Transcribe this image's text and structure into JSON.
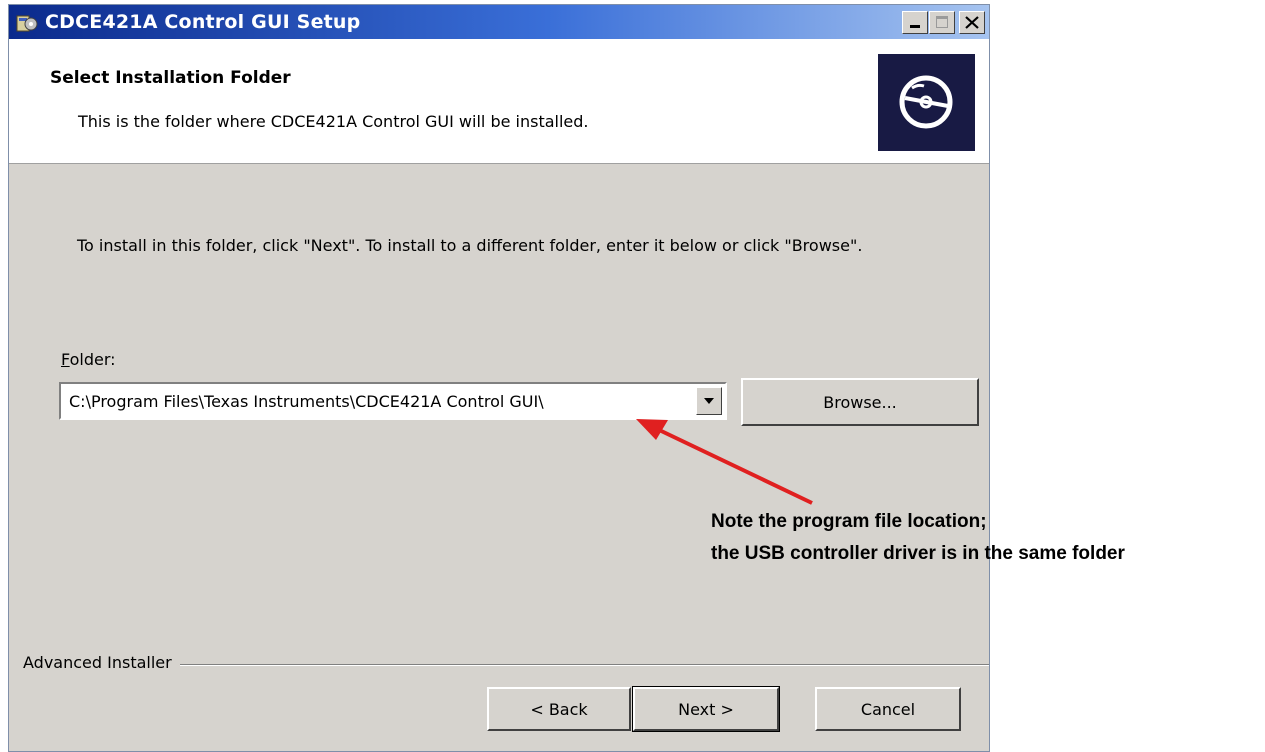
{
  "window": {
    "title": "CDCE421A Control GUI Setup",
    "icon": "installer-icon"
  },
  "banner": {
    "title": "Select Installation Folder",
    "description": "This is the folder where CDCE421A Control GUI will be installed.",
    "logo_icon": "disc-icon"
  },
  "instruction": "To install in this folder, click \"Next\". To install to a different folder, enter it below or click \"Browse\".",
  "folder": {
    "label_accel": "F",
    "label_rest": "older:",
    "value": "C:\\Program Files\\Texas Instruments\\CDCE421A Control GUI\\"
  },
  "buttons": {
    "browse": "Browse...",
    "back": "< Back",
    "next": "Next >",
    "cancel": "Cancel"
  },
  "footer": {
    "brand": "Advanced Installer"
  },
  "annotation": {
    "line1": "Note the program file location;",
    "line2": "the USB controller driver is in the same folder",
    "arrow_color": "#e02020"
  },
  "colors": {
    "dialog_bg": "#d6d3ce",
    "titlebar_start": "#0b2a8c",
    "titlebar_end": "#a6c4f0",
    "logo_bg": "#181a44"
  }
}
